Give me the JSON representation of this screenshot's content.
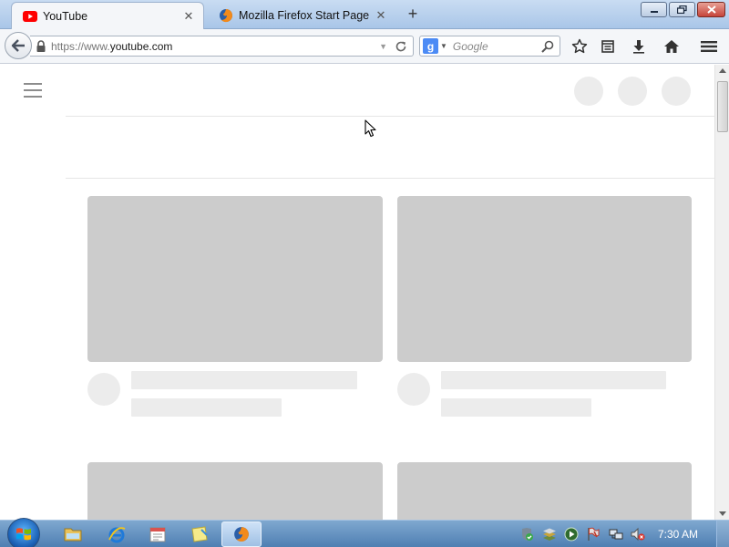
{
  "browser": {
    "tabs": [
      {
        "title": "YouTube",
        "active": true,
        "favicon": "youtube-icon"
      },
      {
        "title": "Mozilla Firefox Start Page",
        "active": false,
        "favicon": "firefox-icon"
      }
    ],
    "new_tab_label": "+",
    "close_glyph": "✕",
    "url_prefix": "https://www.",
    "url_domain": "youtube.com",
    "search_placeholder": "Google",
    "search_engine_letter": "g",
    "toolbar_icons": [
      "bookmark-star-icon",
      "reading-list-icon",
      "downloads-icon",
      "home-icon",
      "menu-icon"
    ]
  },
  "taskbar": {
    "clock": "7:30 AM",
    "pinned": [
      "windows-explorer-icon",
      "internet-explorer-icon",
      "calendar-app-icon",
      "sticky-notes-icon",
      "firefox-icon"
    ],
    "tray": [
      "security-shield-icon",
      "library-icon",
      "media-play-icon",
      "flag-icon",
      "network-icon",
      "volume-muted-icon"
    ]
  },
  "colors": {
    "youtube_red": "#ff0000",
    "placeholder_dark": "#cccccc",
    "placeholder_light": "#ececec",
    "taskbar_blue": "#4f7fb2"
  }
}
